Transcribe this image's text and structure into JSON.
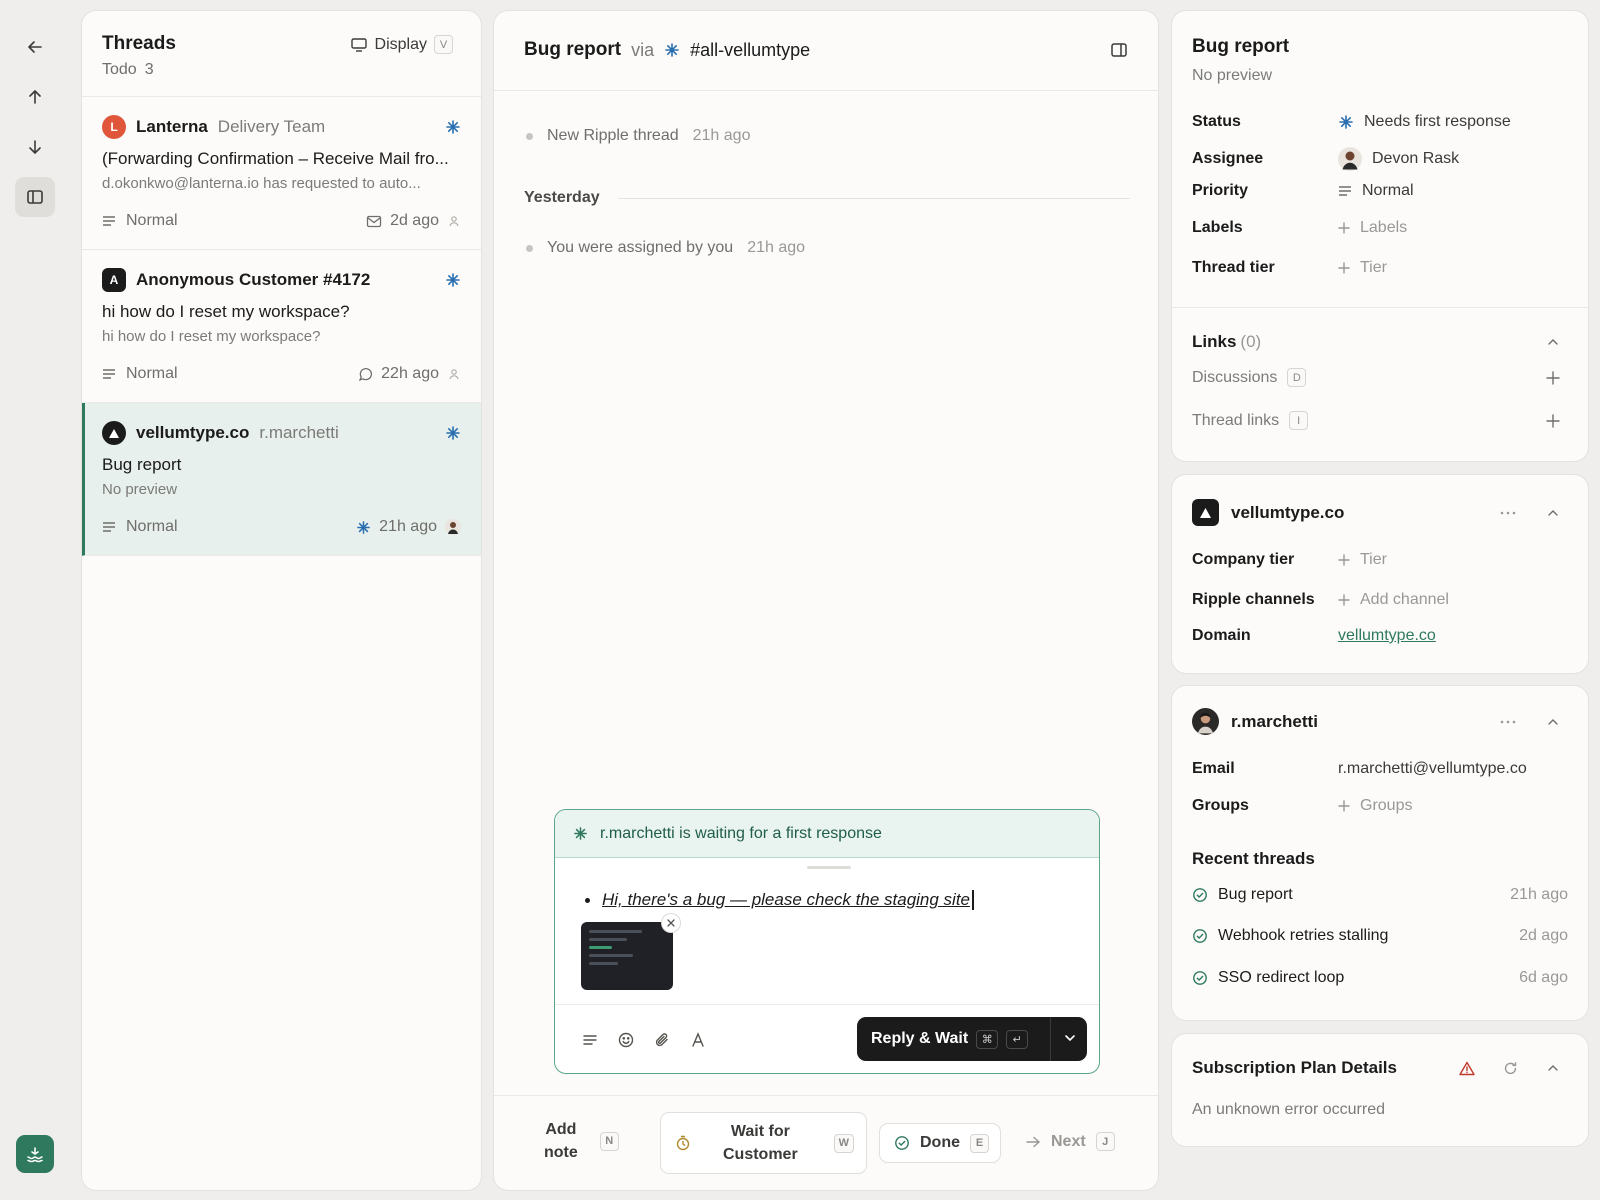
{
  "threads_panel": {
    "title": "Threads",
    "filter_label": "Todo",
    "count": "3",
    "display_label": "Display",
    "display_shortcut": "V",
    "items": [
      {
        "org": "Lanterna",
        "org_initial": "L",
        "org_color": "#e0563b",
        "sub": "Delivery Team",
        "subject": "(Forwarding Confirmation – Receive Mail fro...",
        "preview": "d.okonkwo@lanterna.io has requested to auto...",
        "priority": "Normal",
        "time": "2d ago"
      },
      {
        "org": "Anonymous Customer #4172",
        "org_initial": "A",
        "org_color": "#1b1b1b",
        "sub": "",
        "subject": "hi how do I reset my workspace?",
        "preview": "hi how do I reset my workspace?",
        "priority": "Normal",
        "time": "22h ago"
      },
      {
        "org": "vellumtype.co",
        "org_initial": "▲",
        "org_color": "#1b1b1b",
        "sub": "r.marchetti",
        "subject": "Bug report",
        "preview": "No preview",
        "priority": "Normal",
        "time": "21h ago",
        "selected": true
      }
    ]
  },
  "conversation": {
    "title": "Bug report",
    "via": "via",
    "channel": "#all-vellumtype",
    "events": [
      {
        "text": "New Ripple thread",
        "time": "21h ago"
      },
      {
        "text": "You were assigned by you",
        "time": "21h ago"
      }
    ],
    "divider_label": "Yesterday",
    "composer": {
      "banner": "r.marchetti is waiting for a first response",
      "draft": "Hi, there's a bug — please check the staging site",
      "reply_label": "Reply & Wait",
      "reply_key1": "⌘",
      "reply_key2": "↵"
    },
    "actions": {
      "add_note_line1": "Add",
      "add_note_line2": "note",
      "add_note_key": "N",
      "wait_line1": "Wait for",
      "wait_line2": "Customer",
      "wait_key": "W",
      "done": "Done",
      "done_key": "E",
      "next": "Next",
      "next_key": "J"
    }
  },
  "details": {
    "title": "Bug report",
    "preview": "No preview",
    "status_label": "Status",
    "status_value": "Needs first response",
    "assignee_label": "Assignee",
    "assignee_value": "Devon Rask",
    "priority_label": "Priority",
    "priority_value": "Normal",
    "labels_label": "Labels",
    "labels_value": "Labels",
    "tier_label": "Thread tier",
    "tier_value": "Tier",
    "links_title": "Links",
    "links_count": "(0)",
    "discussions": "Discussions",
    "discussions_key": "D",
    "thread_links": "Thread links",
    "thread_links_key": "I"
  },
  "company": {
    "name": "vellumtype.co",
    "tier_label": "Company tier",
    "tier_value": "Tier",
    "channels_label": "Ripple channels",
    "channels_value": "Add channel",
    "domain_label": "Domain",
    "domain_value": "vellumtype.co"
  },
  "contact": {
    "name": "r.marchetti",
    "email_label": "Email",
    "email_value": "r.marchetti@vellumtype.co",
    "groups_label": "Groups",
    "groups_value": "Groups",
    "recent_title": "Recent threads",
    "recent": [
      {
        "title": "Bug report",
        "time": "21h ago"
      },
      {
        "title": "Webhook retries stalling",
        "time": "2d ago"
      },
      {
        "title": "SSO redirect loop",
        "time": "6d ago"
      }
    ]
  },
  "subscription": {
    "title": "Subscription Plan Details",
    "error": "An unknown error occurred"
  },
  "colors": {
    "accent": "#2f7a5e",
    "star": "#2a6fb0",
    "warning": "#c0392b"
  }
}
